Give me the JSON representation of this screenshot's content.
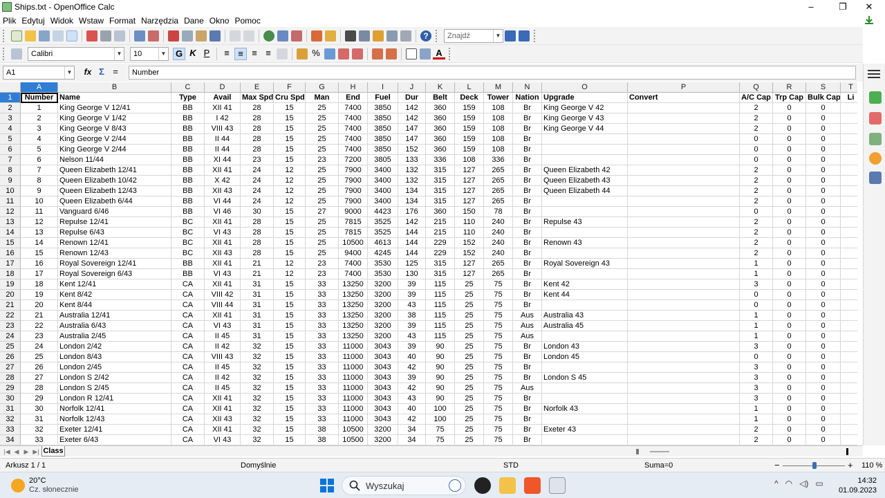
{
  "window": {
    "title": "Ships.txt - OpenOffice Calc",
    "minimize": "–",
    "maximize": "❐",
    "close": "✕"
  },
  "menu": [
    "Plik",
    "Edytuj",
    "Widok",
    "Wstaw",
    "Format",
    "Narzędzia",
    "Dane",
    "Okno",
    "Pomoc"
  ],
  "toolbar": {
    "find_placeholder": "Znajdź",
    "font_name": "Calibri",
    "font_size": "10",
    "bold": "G",
    "italic": "K",
    "underline": "P",
    "percent": "%",
    "help": "?"
  },
  "formula_bar": {
    "cell_ref": "A1",
    "fx": "fx",
    "sum": "Σ",
    "equals": "=",
    "content": "Number"
  },
  "columns": [
    "A",
    "B",
    "C",
    "D",
    "E",
    "F",
    "G",
    "H",
    "I",
    "J",
    "K",
    "L",
    "M",
    "N",
    "O",
    "P",
    "Q",
    "R",
    "S",
    "T"
  ],
  "header": [
    "Number",
    "Name",
    "Type",
    "Avail",
    "Max Spd",
    "Cru Spd",
    "Man",
    "End",
    "Fuel",
    "Dur",
    "Belt",
    "Deck",
    "Tower",
    "Nation",
    "Upgrade",
    "Convert",
    "A/C Cap",
    "Trp Cap",
    "Bulk Cap",
    "Li"
  ],
  "rows": [
    [
      "1",
      "King George V 12/41",
      "BB",
      "XII 41",
      "28",
      "15",
      "25",
      "7400",
      "3850",
      "142",
      "360",
      "159",
      "108",
      "Br",
      "King George V 42",
      "",
      "2",
      "0",
      "0",
      ""
    ],
    [
      "2",
      "King George V 1/42",
      "BB",
      "I 42",
      "28",
      "15",
      "25",
      "7400",
      "3850",
      "142",
      "360",
      "159",
      "108",
      "Br",
      "King George V 43",
      "",
      "2",
      "0",
      "0",
      ""
    ],
    [
      "3",
      "King George V 8/43",
      "BB",
      "VIII 43",
      "28",
      "15",
      "25",
      "7400",
      "3850",
      "147",
      "360",
      "159",
      "108",
      "Br",
      "King George V 44",
      "",
      "2",
      "0",
      "0",
      ""
    ],
    [
      "4",
      "King George V 2/44",
      "BB",
      "II 44",
      "28",
      "15",
      "25",
      "7400",
      "3850",
      "147",
      "360",
      "159",
      "108",
      "Br",
      "",
      "",
      "0",
      "0",
      "0",
      ""
    ],
    [
      "5",
      "King George V 2/44",
      "BB",
      "II 44",
      "28",
      "15",
      "25",
      "7400",
      "3850",
      "152",
      "360",
      "159",
      "108",
      "Br",
      "",
      "",
      "0",
      "0",
      "0",
      ""
    ],
    [
      "6",
      "Nelson 11/44",
      "BB",
      "XI 44",
      "23",
      "15",
      "23",
      "7200",
      "3805",
      "133",
      "336",
      "108",
      "336",
      "Br",
      "",
      "",
      "0",
      "0",
      "0",
      ""
    ],
    [
      "7",
      "Queen Elizabeth 12/41",
      "BB",
      "XII 41",
      "24",
      "12",
      "25",
      "7900",
      "3400",
      "132",
      "315",
      "127",
      "265",
      "Br",
      "Queen Elizabeth 42",
      "",
      "2",
      "0",
      "0",
      ""
    ],
    [
      "8",
      "Queen Elizabeth 10/42",
      "BB",
      "X 42",
      "24",
      "12",
      "25",
      "7900",
      "3400",
      "132",
      "315",
      "127",
      "265",
      "Br",
      "Queen Elizabeth 43",
      "",
      "2",
      "0",
      "0",
      ""
    ],
    [
      "9",
      "Queen Elizabeth 12/43",
      "BB",
      "XII 43",
      "24",
      "12",
      "25",
      "7900",
      "3400",
      "134",
      "315",
      "127",
      "265",
      "Br",
      "Queen Elizabeth 44",
      "",
      "2",
      "0",
      "0",
      ""
    ],
    [
      "10",
      "Queen Elizabeth 6/44",
      "BB",
      "VI 44",
      "24",
      "12",
      "25",
      "7900",
      "3400",
      "134",
      "315",
      "127",
      "265",
      "Br",
      "",
      "",
      "2",
      "0",
      "0",
      ""
    ],
    [
      "11",
      "Vanguard 6/46",
      "BB",
      "VI 46",
      "30",
      "15",
      "27",
      "9000",
      "4423",
      "176",
      "360",
      "150",
      "78",
      "Br",
      "",
      "",
      "0",
      "0",
      "0",
      ""
    ],
    [
      "12",
      "Repulse 12/41",
      "BC",
      "XII 41",
      "28",
      "15",
      "25",
      "7815",
      "3525",
      "142",
      "215",
      "110",
      "240",
      "Br",
      "Repulse 43",
      "",
      "2",
      "0",
      "0",
      ""
    ],
    [
      "13",
      "Repulse 6/43",
      "BC",
      "VI 43",
      "28",
      "15",
      "25",
      "7815",
      "3525",
      "144",
      "215",
      "110",
      "240",
      "Br",
      "",
      "",
      "2",
      "0",
      "0",
      ""
    ],
    [
      "14",
      "Renown 12/41",
      "BC",
      "XII 41",
      "28",
      "15",
      "25",
      "10500",
      "4613",
      "144",
      "229",
      "152",
      "240",
      "Br",
      "Renown 43",
      "",
      "2",
      "0",
      "0",
      ""
    ],
    [
      "15",
      "Renown 12/43",
      "BC",
      "XII 43",
      "28",
      "15",
      "25",
      "9400",
      "4245",
      "144",
      "229",
      "152",
      "240",
      "Br",
      "",
      "",
      "2",
      "0",
      "0",
      ""
    ],
    [
      "16",
      "Royal Sovereign 12/41",
      "BB",
      "XII 41",
      "21",
      "12",
      "23",
      "7400",
      "3530",
      "125",
      "315",
      "127",
      "265",
      "Br",
      "Royal Sovereign 43",
      "",
      "1",
      "0",
      "0",
      ""
    ],
    [
      "17",
      "Royal Sovereign 6/43",
      "BB",
      "VI 43",
      "21",
      "12",
      "23",
      "7400",
      "3530",
      "130",
      "315",
      "127",
      "265",
      "Br",
      "",
      "",
      "1",
      "0",
      "0",
      ""
    ],
    [
      "18",
      "Kent 12/41",
      "CA",
      "XII 41",
      "31",
      "15",
      "33",
      "13250",
      "3200",
      "39",
      "115",
      "25",
      "75",
      "Br",
      "Kent 42",
      "",
      "3",
      "0",
      "0",
      ""
    ],
    [
      "19",
      "Kent 8/42",
      "CA",
      "VIII 42",
      "31",
      "15",
      "33",
      "13250",
      "3200",
      "39",
      "115",
      "25",
      "75",
      "Br",
      "Kent 44",
      "",
      "0",
      "0",
      "0",
      ""
    ],
    [
      "20",
      "Kent 8/44",
      "CA",
      "VIII 44",
      "31",
      "15",
      "33",
      "13250",
      "3200",
      "43",
      "115",
      "25",
      "75",
      "Br",
      "",
      "",
      "0",
      "0",
      "0",
      ""
    ],
    [
      "21",
      "Australia 12/41",
      "CA",
      "XII 41",
      "31",
      "15",
      "33",
      "13250",
      "3200",
      "38",
      "115",
      "25",
      "75",
      "Aus",
      "Australia 43",
      "",
      "1",
      "0",
      "0",
      ""
    ],
    [
      "22",
      "Australia 6/43",
      "CA",
      "VI 43",
      "31",
      "15",
      "33",
      "13250",
      "3200",
      "39",
      "115",
      "25",
      "75",
      "Aus",
      "Australia 45",
      "",
      "1",
      "0",
      "0",
      ""
    ],
    [
      "23",
      "Australia 2/45",
      "CA",
      "II 45",
      "31",
      "15",
      "33",
      "13250",
      "3200",
      "43",
      "115",
      "25",
      "75",
      "Aus",
      "",
      "",
      "1",
      "0",
      "0",
      ""
    ],
    [
      "24",
      "London 2/42",
      "CA",
      "II 42",
      "32",
      "15",
      "33",
      "11000",
      "3043",
      "39",
      "90",
      "25",
      "75",
      "Br",
      "London 43",
      "",
      "3",
      "0",
      "0",
      ""
    ],
    [
      "25",
      "London 8/43",
      "CA",
      "VIII 43",
      "32",
      "15",
      "33",
      "11000",
      "3043",
      "40",
      "90",
      "25",
      "75",
      "Br",
      "London 45",
      "",
      "0",
      "0",
      "0",
      ""
    ],
    [
      "26",
      "London 2/45",
      "CA",
      "II 45",
      "32",
      "15",
      "33",
      "11000",
      "3043",
      "42",
      "90",
      "25",
      "75",
      "Br",
      "",
      "",
      "3",
      "0",
      "0",
      ""
    ],
    [
      "27",
      "London S 2/42",
      "CA",
      "II 42",
      "32",
      "15",
      "33",
      "11000",
      "3043",
      "39",
      "90",
      "25",
      "75",
      "Br",
      "London S 45",
      "",
      "3",
      "0",
      "0",
      ""
    ],
    [
      "28",
      "London S 2/45",
      "CA",
      "II 45",
      "32",
      "15",
      "33",
      "11000",
      "3043",
      "42",
      "90",
      "25",
      "75",
      "Aus",
      "",
      "",
      "3",
      "0",
      "0",
      ""
    ],
    [
      "29",
      "London R 12/41",
      "CA",
      "XII 41",
      "32",
      "15",
      "33",
      "11000",
      "3043",
      "43",
      "90",
      "25",
      "75",
      "Br",
      "",
      "",
      "3",
      "0",
      "0",
      ""
    ],
    [
      "30",
      "Norfolk 12/41",
      "CA",
      "XII 41",
      "32",
      "15",
      "33",
      "11000",
      "3043",
      "40",
      "100",
      "25",
      "75",
      "Br",
      "Norfolk 43",
      "",
      "1",
      "0",
      "0",
      ""
    ],
    [
      "31",
      "Norfolk 12/43",
      "CA",
      "XII 43",
      "32",
      "15",
      "33",
      "11000",
      "3043",
      "42",
      "100",
      "25",
      "75",
      "Br",
      "",
      "",
      "1",
      "0",
      "0",
      ""
    ],
    [
      "32",
      "Exeter 12/41",
      "CA",
      "XII 41",
      "32",
      "15",
      "38",
      "10500",
      "3200",
      "34",
      "75",
      "25",
      "75",
      "Br",
      "Exeter 43",
      "",
      "2",
      "0",
      "0",
      ""
    ],
    [
      "33",
      "Exeter 6/43",
      "CA",
      "VI 43",
      "32",
      "15",
      "38",
      "10500",
      "3200",
      "34",
      "75",
      "25",
      "75",
      "Br",
      "",
      "",
      "2",
      "0",
      "0",
      ""
    ]
  ],
  "sheet_tab": "Class",
  "status": {
    "sheet": "Arkusz 1 / 1",
    "style": "Domyślnie",
    "mode": "STD",
    "sum": "Suma=0",
    "zoom": "110 %",
    "zoom_minus": "−",
    "zoom_plus": "+"
  },
  "taskbar": {
    "weather_temp": "20°C",
    "weather_cond": "Cz. słonecznie",
    "search": "Wyszukaj",
    "time": "14:32",
    "date": "01.09.2023",
    "tray_chevron": "^",
    "tray_wifi": "◠",
    "tray_speaker": "◁)",
    "tray_battery": "▭"
  },
  "colors": {
    "selection": "#2f7dd4",
    "toolbar_bg": "#f3f3f3",
    "grid_line": "#d6d6d6"
  }
}
